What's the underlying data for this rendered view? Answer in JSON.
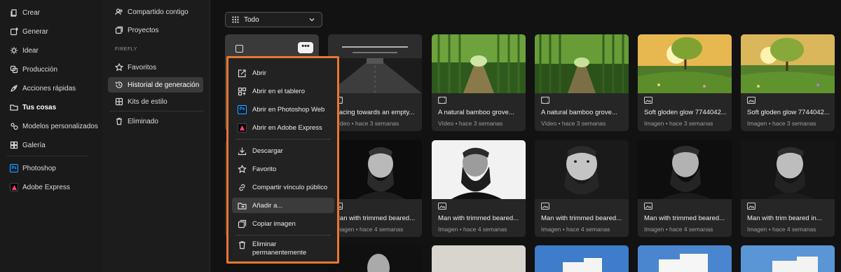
{
  "nav": {
    "items": [
      {
        "label": "Crear",
        "icon": "create-icon"
      },
      {
        "label": "Generar",
        "icon": "generate-icon"
      },
      {
        "label": "Idear",
        "icon": "ideate-icon"
      },
      {
        "label": "Producción",
        "icon": "production-icon"
      },
      {
        "label": "Acciones rápidas",
        "icon": "quick-actions-icon"
      },
      {
        "label": "Tus cosas",
        "icon": "folder-icon"
      },
      {
        "label": "Modelos personalizados",
        "icon": "custom-models-icon"
      },
      {
        "label": "Galería",
        "icon": "gallery-icon"
      }
    ],
    "apps": [
      {
        "label": "Photoshop",
        "icon": "photoshop-icon"
      },
      {
        "label": "Adobe Express",
        "icon": "adobe-express-icon"
      }
    ]
  },
  "side": {
    "shared": "Compartido contigo",
    "projects": "Proyectos",
    "section_header": "FIREFLY",
    "favorites": "Favoritos",
    "history": "Historial de generación",
    "style_kits": "Kits de estilo",
    "deleted": "Eliminado"
  },
  "filter": {
    "label": "Todo"
  },
  "menu": {
    "open": "Abrir",
    "open_board": "Abrir en el tablero",
    "open_ps": "Abrir en Photoshop Web",
    "open_express": "Abrir en Adobe Express",
    "download": "Descargar",
    "favorite": "Favorito",
    "share": "Compartir vínculo público",
    "add_to": "Añadir a...",
    "copy_image": "Copiar imagen",
    "delete_line1": "Eliminar",
    "delete_line2": "permanentemente"
  },
  "cards": {
    "r1c2": {
      "title": "Racing towards an empty...",
      "meta": "Vídeo • hace 3 semanas"
    },
    "r1c3": {
      "title": "A natural bamboo grove...",
      "meta": "Vídeo • hace 3 semanas"
    },
    "r1c4": {
      "title": "A natural bamboo grove...",
      "meta": "Vídeo • hace 3 semanas"
    },
    "r1c5": {
      "title": "Soft gloden glow 7744042...",
      "meta": "Imagen • hace 3 semanas"
    },
    "r1c6": {
      "title": "Soft gloden glow 7744042...",
      "meta": "Imagen • hace 3 semanas"
    },
    "r2c2": {
      "title": "Man with trimmed beared...",
      "meta": "Imagen • hace 4 semanas"
    },
    "r2c3": {
      "title": "Man with trimmed beared...",
      "meta": "Imagen • hace 4 semanas"
    },
    "r2c4": {
      "title": "Man with trimmed beared...",
      "meta": "Imagen • hace 4 semanas"
    },
    "r2c5": {
      "title": "Man with trimmed beared...",
      "meta": "Imagen • hace 4 semanas"
    },
    "r2c6": {
      "title": "Man with trim beared in...",
      "meta": "Imagen • hace 4 semanas"
    }
  },
  "colors": {
    "accent": "#e8772e",
    "ps_blue": "#001e36",
    "express_grad": "#ff2d55"
  }
}
